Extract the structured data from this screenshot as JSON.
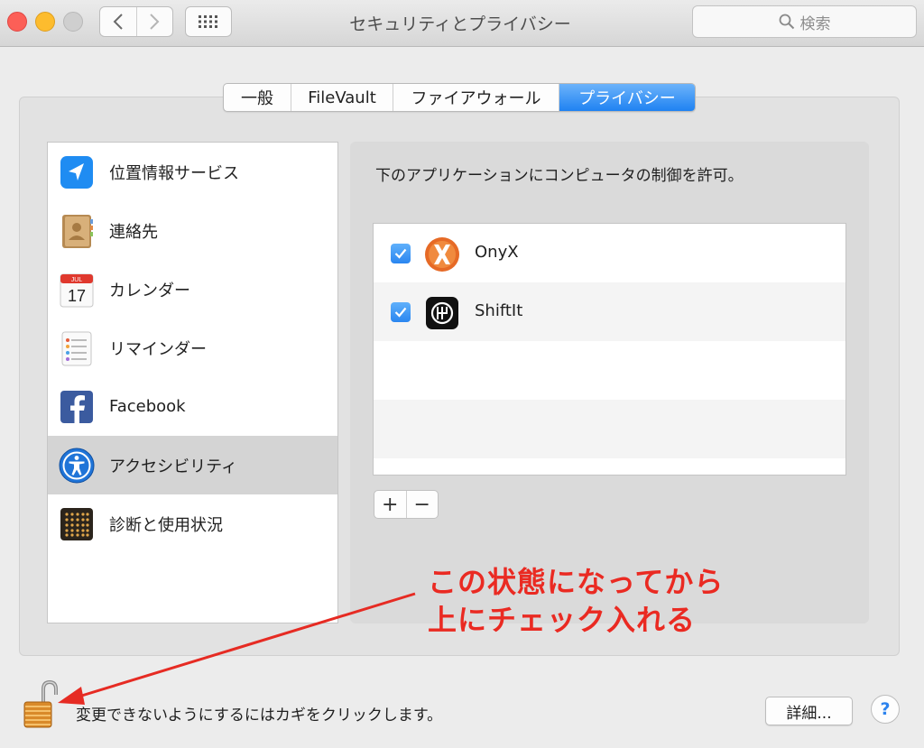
{
  "window": {
    "title": "セキュリティとプライバシー",
    "search_placeholder": "検索"
  },
  "icons": {
    "back": "chevron-left-icon",
    "forward": "chevron-right-icon",
    "show_all": "grid-icon",
    "search": "search-icon"
  },
  "tabs": [
    {
      "label": "一般",
      "active": false
    },
    {
      "label": "FileVault",
      "active": false
    },
    {
      "label": "ファイアウォール",
      "active": false
    },
    {
      "label": "プライバシー",
      "active": true
    }
  ],
  "sidebar": {
    "items": [
      {
        "label": "位置情報サービス",
        "icon": "location-icon",
        "selected": false
      },
      {
        "label": "連絡先",
        "icon": "contacts-icon",
        "selected": false
      },
      {
        "label": "カレンダー",
        "icon": "calendar-icon",
        "selected": false,
        "icon_month": "JUL",
        "icon_day": "17"
      },
      {
        "label": "リマインダー",
        "icon": "reminders-icon",
        "selected": false
      },
      {
        "label": "Facebook",
        "icon": "facebook-icon",
        "selected": false
      },
      {
        "label": "アクセシビリティ",
        "icon": "accessibility-icon",
        "selected": true
      },
      {
        "label": "診断と使用状況",
        "icon": "diagnostics-icon",
        "selected": false
      }
    ]
  },
  "main": {
    "description": "下のアプリケーションにコンピュータの制御を許可。",
    "apps": [
      {
        "name": "OnyX",
        "checked": true,
        "icon": "onyx-icon"
      },
      {
        "name": "ShiftIt",
        "checked": true,
        "icon": "shiftit-icon"
      }
    ],
    "add_label": "+",
    "remove_label": "−"
  },
  "annotation": {
    "line1": "この状態になってから",
    "line2": "上にチェック入れる",
    "color": "#ea2a22"
  },
  "footer": {
    "lock_text": "変更できないようにするにはカギをクリックします。",
    "advanced_label": "詳細...",
    "help_label": "?"
  },
  "colors": {
    "accent": "#2a86f0",
    "close": "#fc5f57",
    "minimize": "#fdbc2e",
    "maximize": "#cfcfcf"
  }
}
